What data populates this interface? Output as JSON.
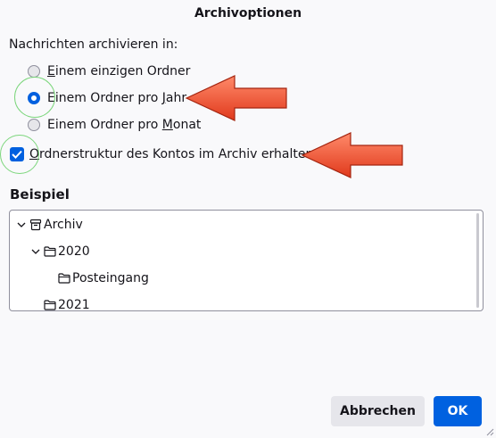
{
  "dialog": {
    "title": "Archivoptionen"
  },
  "archive": {
    "label": "Nachrichten archivieren in:",
    "options": [
      {
        "prefix": "",
        "mnemonic": "E",
        "suffix": "inem einzigen Ordner",
        "checked": false
      },
      {
        "prefix": "Einem Ordner pro ",
        "mnemonic": "J",
        "suffix": "ahr",
        "checked": true
      },
      {
        "prefix": "Einem Ordner pro ",
        "mnemonic": "M",
        "suffix": "onat",
        "checked": false
      }
    ],
    "keep_structure": {
      "mnemonic": "O",
      "suffix": "rdnerstruktur des Kontos im Archiv erhalten",
      "checked": true
    }
  },
  "example": {
    "title": "Beispiel",
    "tree": [
      {
        "label": "Archiv",
        "icon": "archive-box-icon",
        "expanded": true
      },
      {
        "label": "2020",
        "icon": "folder-icon",
        "expanded": true
      },
      {
        "label": "Posteingang",
        "icon": "folder-icon"
      },
      {
        "label": "2021",
        "icon": "folder-icon"
      }
    ]
  },
  "buttons": {
    "cancel": "Abbrechen",
    "ok": "OK"
  },
  "colors": {
    "accent": "#0060df",
    "arrow": "#ee4f2c",
    "highlight": "#7cd67c"
  }
}
